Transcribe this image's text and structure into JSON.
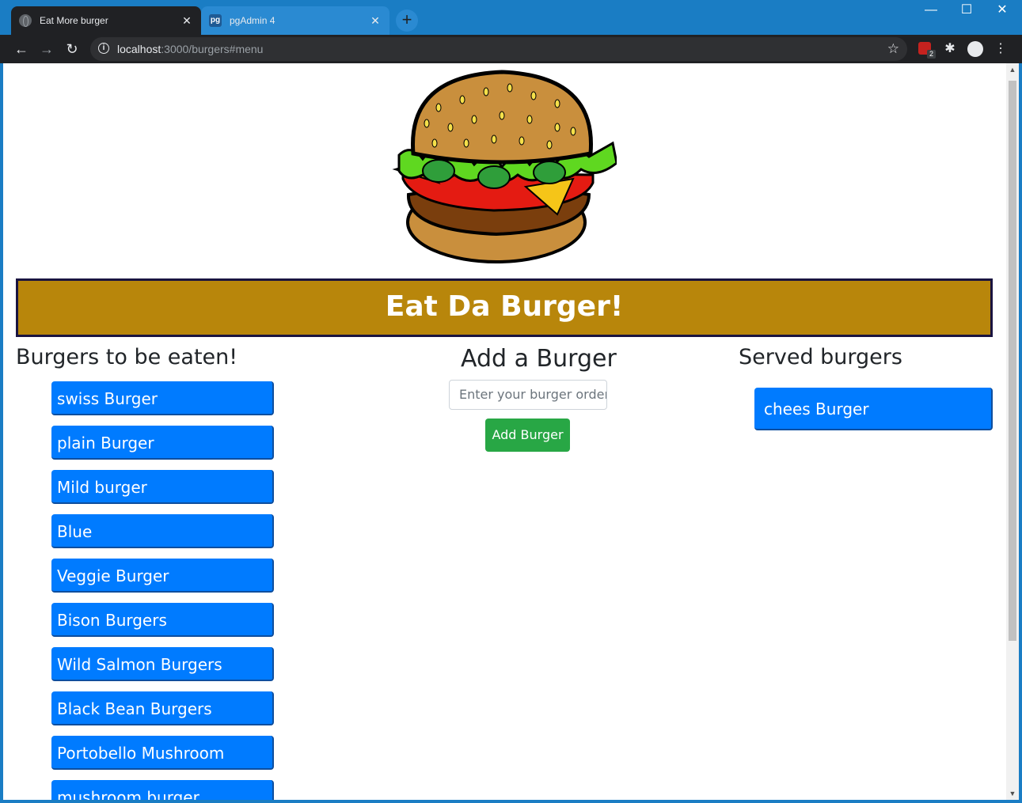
{
  "browser": {
    "tabs": [
      {
        "title": "Eat More burger",
        "active": true
      },
      {
        "title": "pgAdmin 4",
        "active": false
      }
    ],
    "url_host": "localhost",
    "url_path": ":3000/burgers#menu",
    "extension_badge": "2",
    "icons": [
      "back-icon",
      "forward-icon",
      "reload-icon",
      "info-icon",
      "star-icon",
      "extension-icon",
      "puzzle-icon",
      "profile-icon",
      "menu-icon"
    ]
  },
  "page": {
    "banner_title": "Eat Da Burger!",
    "colors": {
      "banner_bg": "#b8860b",
      "banner_border": "#1a1440",
      "burger_button": "#007bff",
      "add_button": "#28a745"
    },
    "left_column": {
      "heading": "Burgers to be eaten!",
      "burgers": [
        "swiss Burger",
        "plain Burger",
        "Mild burger",
        "Blue",
        "Veggie Burger",
        "Bison Burgers",
        "Wild Salmon Burgers",
        "Black Bean Burgers",
        "Portobello Mushroom Burgers",
        "mushroom burger"
      ]
    },
    "center_column": {
      "heading": "Add a Burger",
      "input_placeholder": "Enter your burger order here",
      "button_label": "Add Burger"
    },
    "right_column": {
      "heading": "Served burgers",
      "burgers": [
        "chees Burger"
      ]
    }
  }
}
